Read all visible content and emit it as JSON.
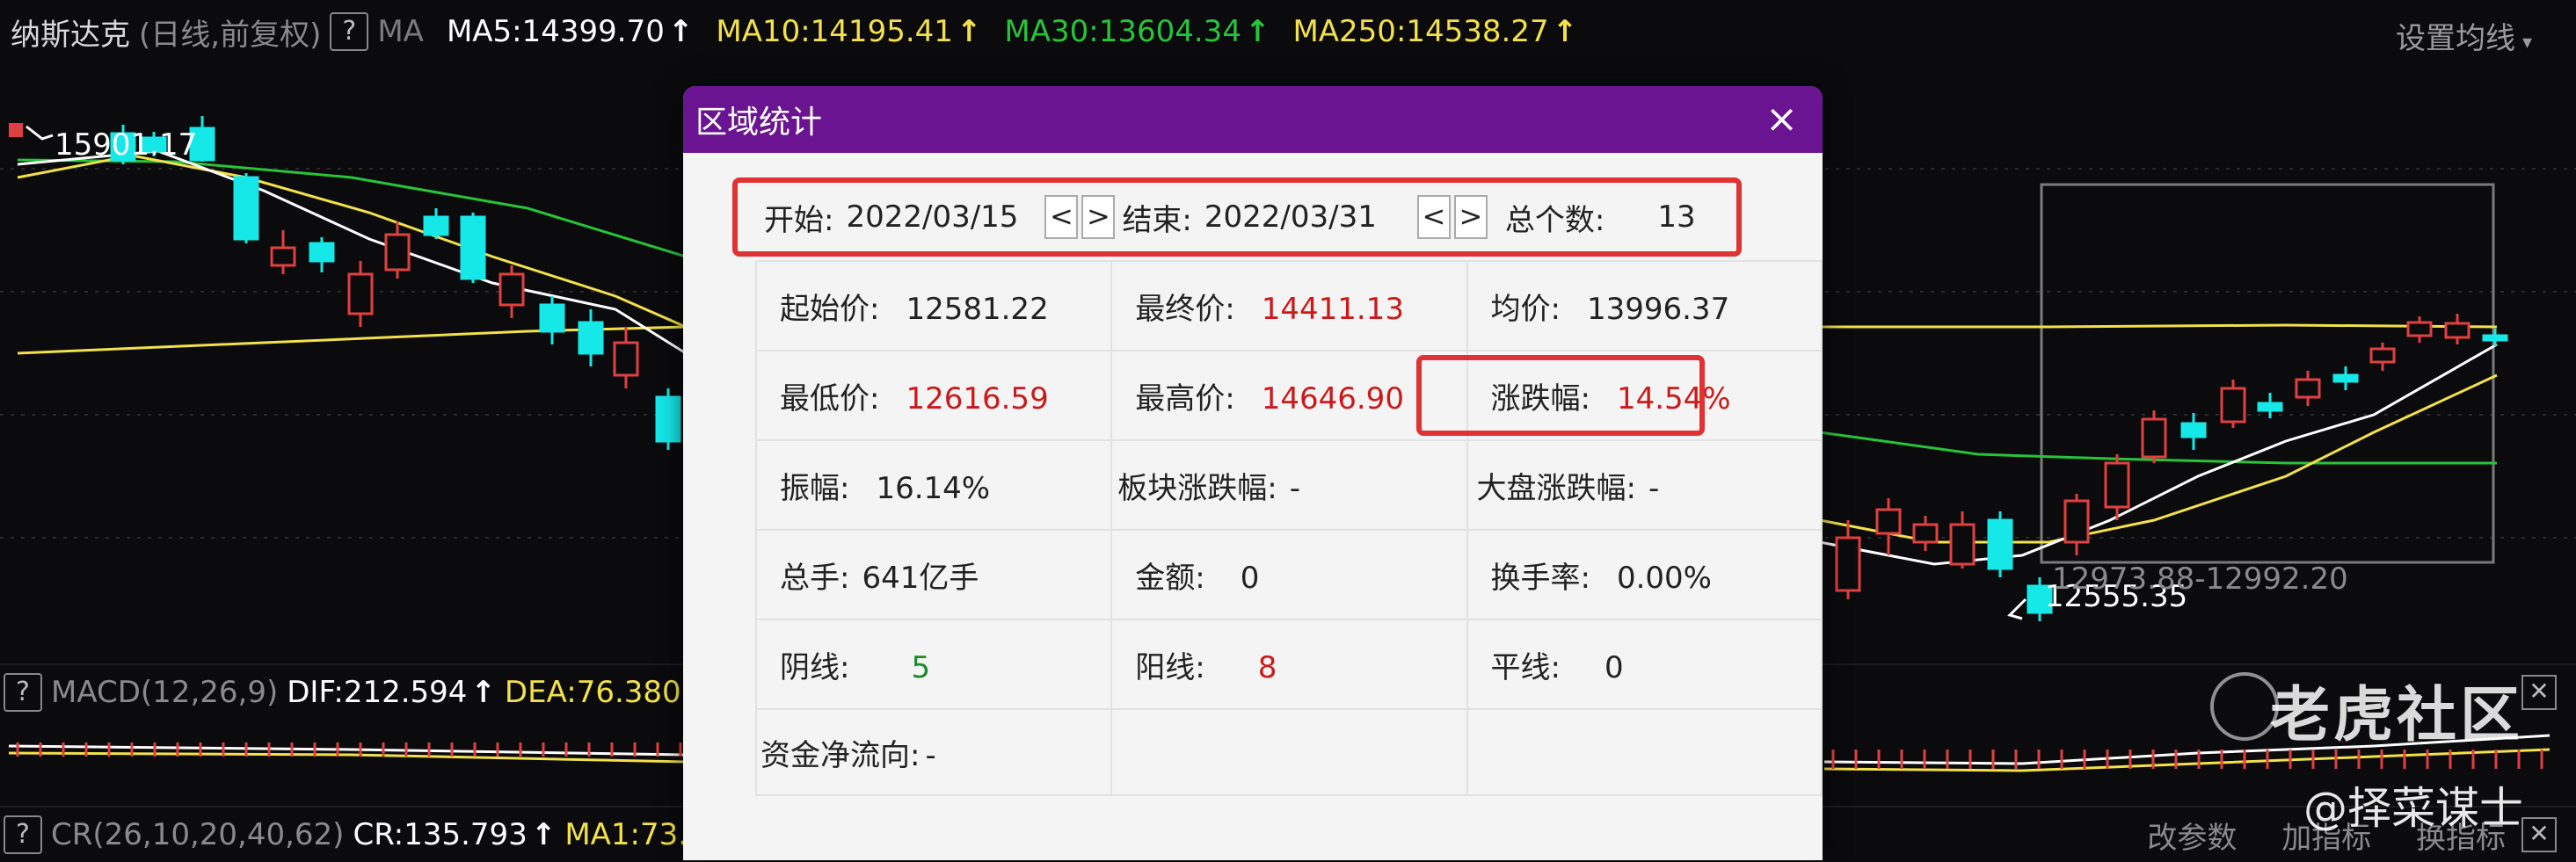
{
  "header": {
    "symbol": "纳斯达克",
    "mode": "(日线,前复权)",
    "help": "?",
    "ma_label": "MA",
    "ma5": "MA5:14399.70",
    "ma10": "MA10:14195.41",
    "ma30": "MA30:13604.34",
    "ma250": "MA250:14538.27",
    "up_arrow": "↑",
    "setting": "设置均线",
    "setting_caret": "▾"
  },
  "chart": {
    "high_label": "15901.17",
    "low_label": "12555.35",
    "range_label": "12973.88-12992.20"
  },
  "indicators": {
    "macd_name": "MACD(12,26,9)",
    "dif": "DIF:212.594",
    "dea": "DEA:76.380",
    "cr_name": "CR(26,10,20,40,62)",
    "cr": "CR:135.793",
    "ma1": "MA1:73.",
    "change_params": "改参数",
    "add_indicator": "加指标",
    "switch_indicator": "换指标",
    "close": "✕",
    "help": "?"
  },
  "watermark": {
    "logo": "老虎社区",
    "user": "@择菜谋士"
  },
  "dialog": {
    "title": "区域统计",
    "close": "×",
    "start_label": "开始:",
    "start_date": "2022/03/15",
    "end_label": "结束:",
    "end_date": "2022/03/31",
    "prev": "<",
    "next": ">",
    "count_label": "总个数:",
    "count": "13",
    "rows": [
      [
        {
          "label": "起始价:",
          "value": "12581.22"
        },
        {
          "label": "最终价:",
          "value": "14411.13"
        },
        {
          "label": "均价:",
          "value": "13996.37"
        }
      ],
      [
        {
          "label": "最低价:",
          "value": "12616.59"
        },
        {
          "label": "最高价:",
          "value": "14646.90"
        },
        {
          "label": "涨跌幅:",
          "value": "14.54%"
        }
      ],
      [
        {
          "label": "振幅:",
          "value": "16.14%"
        },
        {
          "label": "板块涨跌幅:",
          "value": "-"
        },
        {
          "label": "大盘涨跌幅:",
          "value": "-"
        }
      ],
      [
        {
          "label": "总手:",
          "value": "641亿手"
        },
        {
          "label": "金额:",
          "value": "0"
        },
        {
          "label": "换手率:",
          "value": "0.00%"
        }
      ],
      [
        {
          "label": "阴线:",
          "value": "5"
        },
        {
          "label": "阳线:",
          "value": "8"
        },
        {
          "label": "平线:",
          "value": "0"
        }
      ],
      [
        {
          "label": "资金净流向:",
          "value": "-"
        },
        {
          "label": "",
          "value": ""
        },
        {
          "label": "",
          "value": ""
        }
      ]
    ]
  },
  "colors": {
    "ma5": "#ffffff",
    "ma10": "#f2e14a",
    "ma30": "#27c43a",
    "ma250": "#f2e14a",
    "dialog_header": "#6a1492",
    "highlight": "#e03232",
    "up_candle": "#e04040",
    "down_candle": "#16e8e8"
  }
}
